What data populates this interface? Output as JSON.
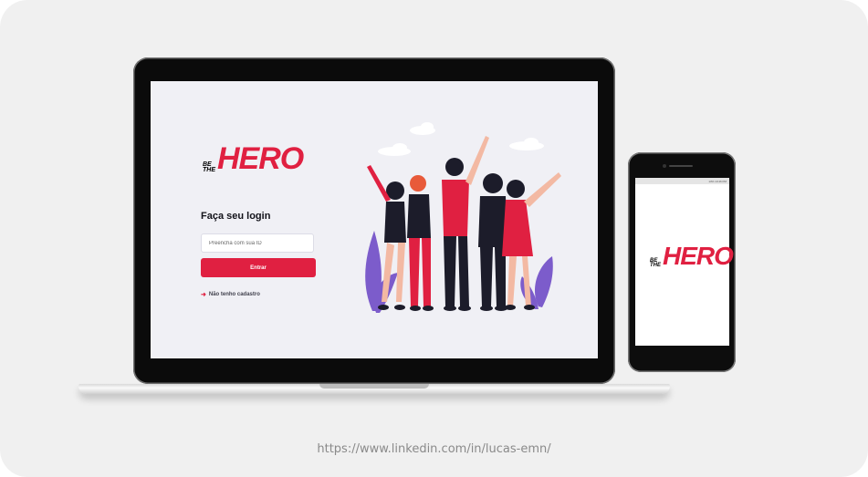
{
  "brand": {
    "be": "BE",
    "the": "THE",
    "hero": "HERO",
    "accent_color": "#E02041"
  },
  "login": {
    "title": "Faça seu login",
    "id_placeholder": "Preencha com sua ID",
    "submit_label": "Entrar",
    "register_link": "Não tenho cadastro",
    "register_icon": "log-in-arrow-icon"
  },
  "phone": {
    "status_text": "13% 10:46 PM"
  },
  "footer": {
    "url": "https://www.linkedin.com/in/lucas-emn/"
  }
}
